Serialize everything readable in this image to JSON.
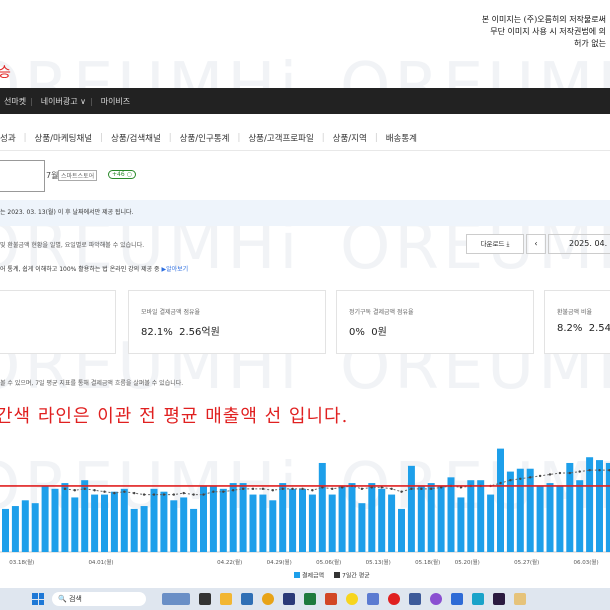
{
  "notice": {
    "line1": "본 이미지는 (주)오름히의 저작물로써",
    "line2": "무단 이미지 사용 시 저작권법에 의",
    "line3": "허가 없는"
  },
  "red_title": "승",
  "topbar": {
    "item1": "선마켓",
    "item2": "네이버광고 ∨",
    "item3": "마이비즈"
  },
  "tabs": [
    "성과",
    "상품/마케팅채널",
    "상품/검색채널",
    "상품/인구통계",
    "상품/고객프로파일",
    "상품/지역",
    "배송통계"
  ],
  "store": {
    "suffix": "7월",
    "badge": "스마트스토어",
    "pill": "+46 ○"
  },
  "info_band": "는 2023. 03. 13(월) 이 후 날짜에서만 제공 됩니다.",
  "description": "및 환불금액 현황을 일별, 요일별로 파악해볼 수 있습니다.",
  "download_label": "다운로드 ⤓",
  "prev_label": "‹",
  "date_value": "2025. 04. 0",
  "guide": {
    "text": "어 통계, 쉽게 이해하고 100% 활용하는 법 온라인 강의 제공 중",
    "link": "▶알아보기"
  },
  "stats": [
    {
      "label": "모바일 결제금액 점유율",
      "pct": "82.1%",
      "amount": "2.56억원"
    },
    {
      "label": "정기구독 결제금액 점유율",
      "pct": "0%",
      "amount": "0원"
    },
    {
      "label": "환불금액 비율",
      "pct": "8.2%",
      "amount": "2.54"
    }
  ],
  "chart_description": "볼 수 있으며, 7일 평균 지표를 통해 결제금액 흐름을 살펴볼 수 있습니다.",
  "annotation": "간색 라인은 이관 전 평균 매출액 선 입니다.",
  "watermark": "OREUMHi",
  "chart_data": {
    "type": "bar",
    "x_labels": [
      "03.18(월)",
      "04.01(월)",
      "04.22(월)",
      "04.29(월)",
      "05.06(월)",
      "05.13(월)",
      "05.18(월)",
      "05.20(월)",
      "05.27(월)",
      "06.03(월)"
    ],
    "values": [
      30,
      32,
      36,
      34,
      46,
      44,
      48,
      38,
      50,
      40,
      40,
      42,
      44,
      30,
      32,
      44,
      42,
      36,
      38,
      30,
      46,
      46,
      44,
      48,
      48,
      40,
      40,
      36,
      48,
      44,
      44,
      40,
      62,
      40,
      46,
      48,
      34,
      48,
      44,
      40,
      30,
      60,
      46,
      48,
      46,
      52,
      38,
      50,
      50,
      40,
      72,
      56,
      58,
      58,
      46,
      48,
      46,
      62,
      50,
      66,
      64,
      62
    ],
    "moving_avg": [
      null,
      null,
      null,
      null,
      null,
      null,
      44,
      43,
      44,
      43,
      42,
      41,
      42,
      41,
      40,
      40,
      40,
      40,
      41,
      40,
      40,
      42,
      42,
      43,
      44,
      44,
      44,
      43,
      44,
      44,
      44,
      43,
      45,
      44,
      45,
      46,
      44,
      45,
      45,
      44,
      42,
      44,
      44,
      44,
      45,
      46,
      45,
      46,
      46,
      46,
      48,
      50,
      51,
      52,
      53,
      54,
      55,
      55,
      56,
      57,
      57,
      57
    ],
    "reference_line": 46,
    "legend": [
      "결제금액",
      "7일간 평균"
    ],
    "colors": {
      "bar": "#1d9fea",
      "avg": "#666666",
      "reference": "#e02020"
    }
  },
  "taskbar": {
    "search_label": "검색"
  }
}
